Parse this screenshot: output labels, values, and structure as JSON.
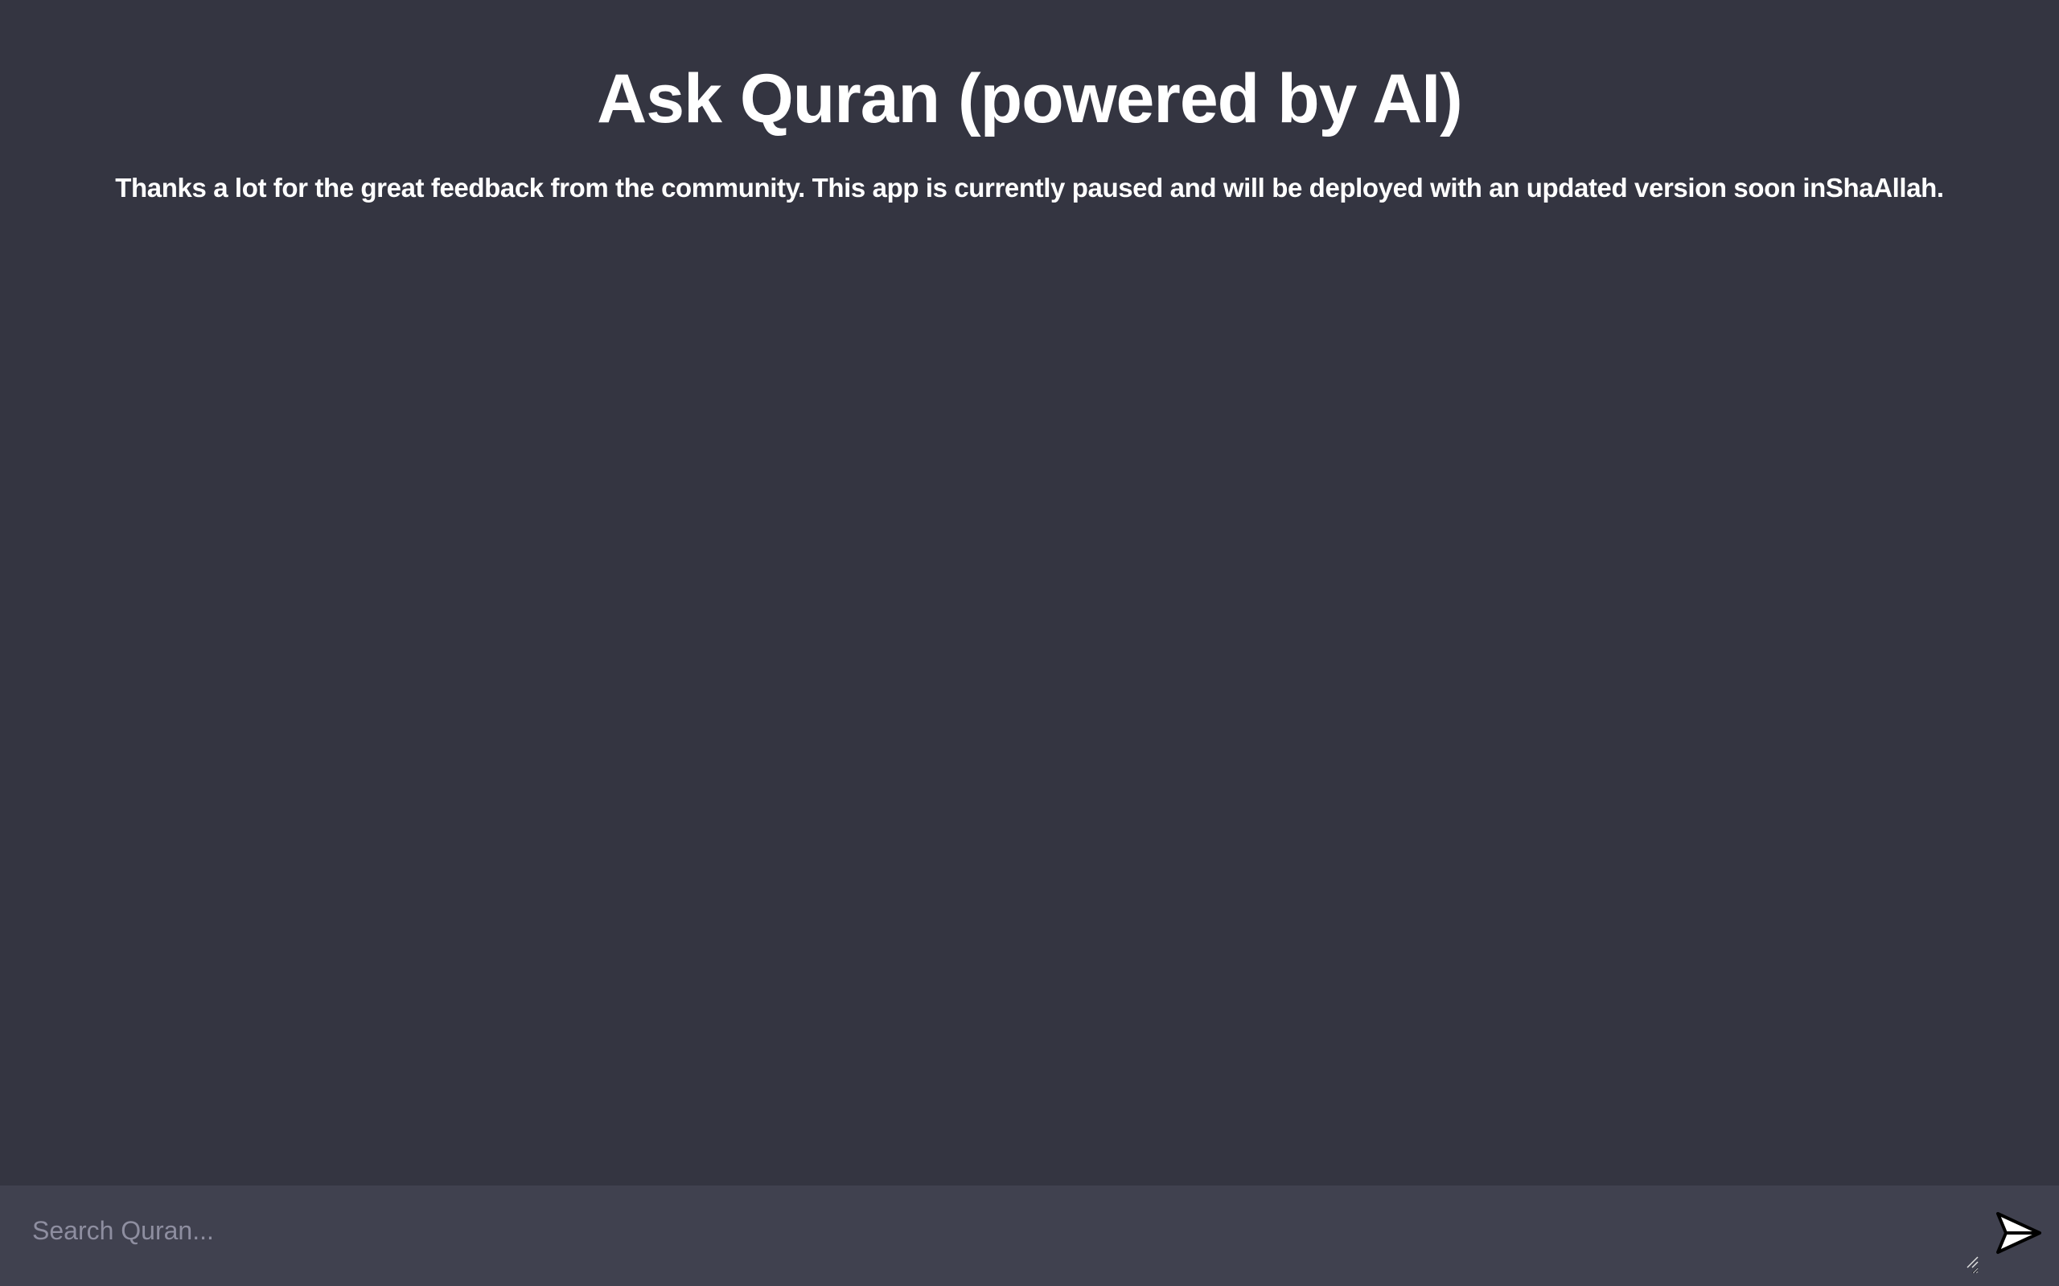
{
  "header": {
    "title": "Ask Quran (powered by AI)",
    "notice": "Thanks a lot for the great feedback from the community. This app is currently paused and will be deployed with an updated version soon inShaAllah."
  },
  "composer": {
    "search_placeholder": "Search Quran...",
    "search_value": "",
    "send_icon": "send-icon"
  },
  "colors": {
    "background": "#343541",
    "composer_background": "#40414f",
    "text": "#ffffff",
    "placeholder": "#8e8ea0"
  }
}
